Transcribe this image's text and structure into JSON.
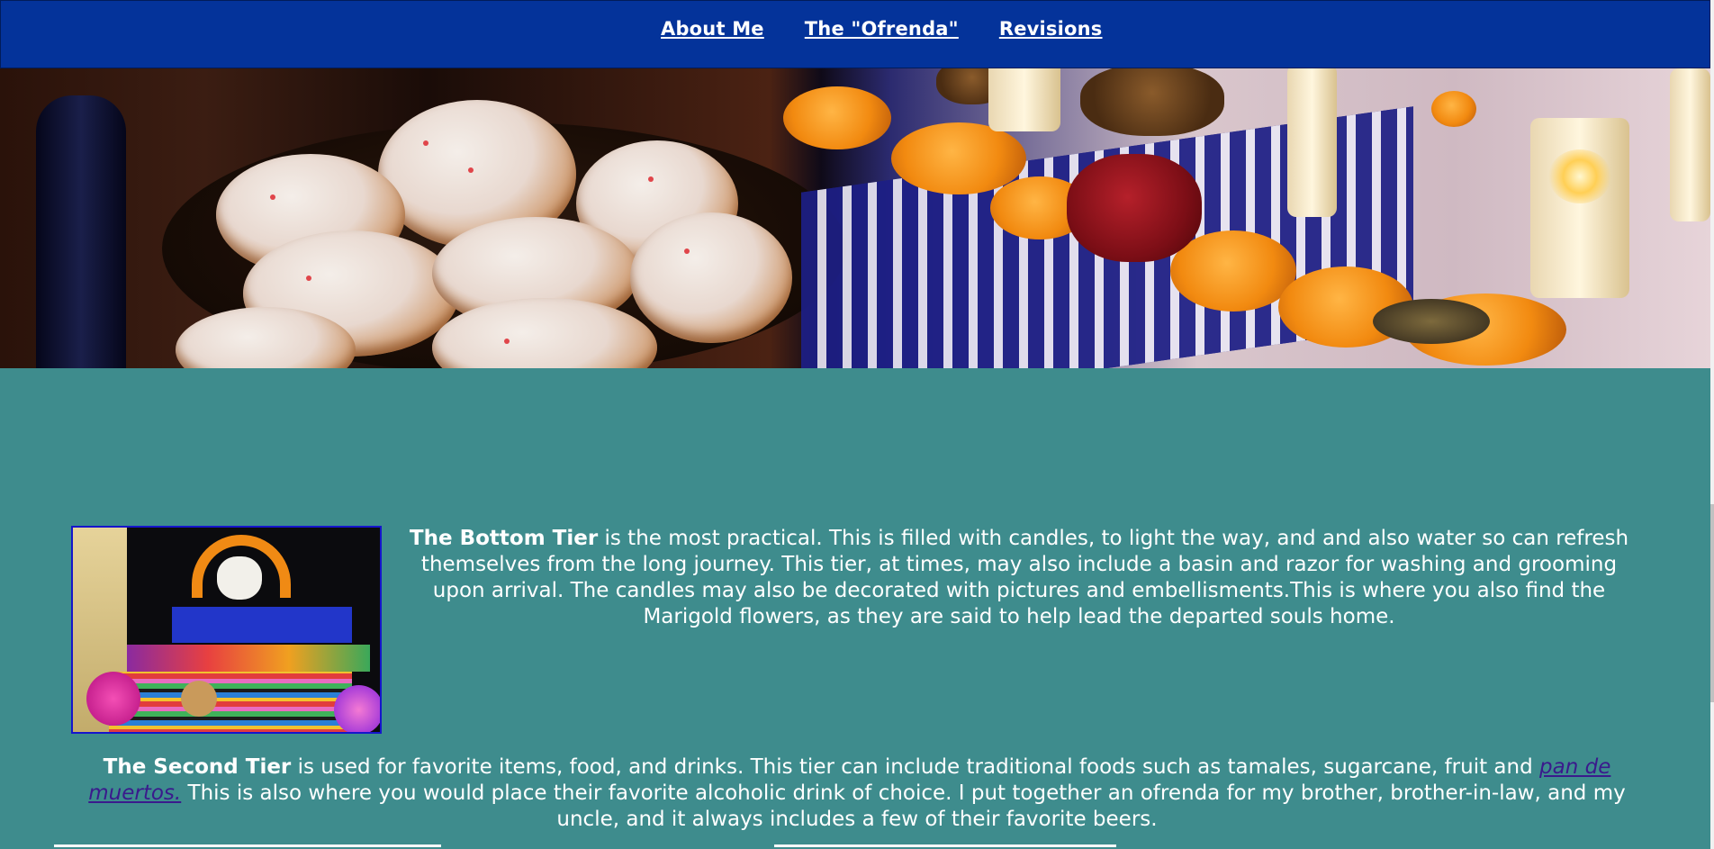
{
  "nav": {
    "about": "About Me",
    "ofrenda": "The \"Ofrenda\"",
    "revisions": "Revisions"
  },
  "content": {
    "tier1": {
      "title": "The Bottom Tier",
      "text": " is the most practical. This is filled with candles, to light the way, and and also water so can refresh themselves from the long journey. This tier, at times, may also include a basin and razor for washing and grooming upon arrival. The candles may also be decorated with pictures and embellisments.This is where you also find the Marigold flowers, as they are said to help lead the departed souls home."
    },
    "tier2": {
      "title": "The Second Tier",
      "text_before": " is used for favorite items, food, and drinks. This tier can include traditional foods such as tamales, sugarcane, fruit and ",
      "link": "pan de muertos.",
      "text_after": " This is also where you would place their favorite alcoholic drink of choice. I put together an ofrenda for my brother, brother-in-law, and my uncle, and it always includes a few of their favorite beers."
    }
  },
  "colors": {
    "nav_bg": "#04339a",
    "page_bg": "#3e8c8d",
    "link_visited": "#3a1a8c",
    "photo_border": "#1515cc"
  }
}
